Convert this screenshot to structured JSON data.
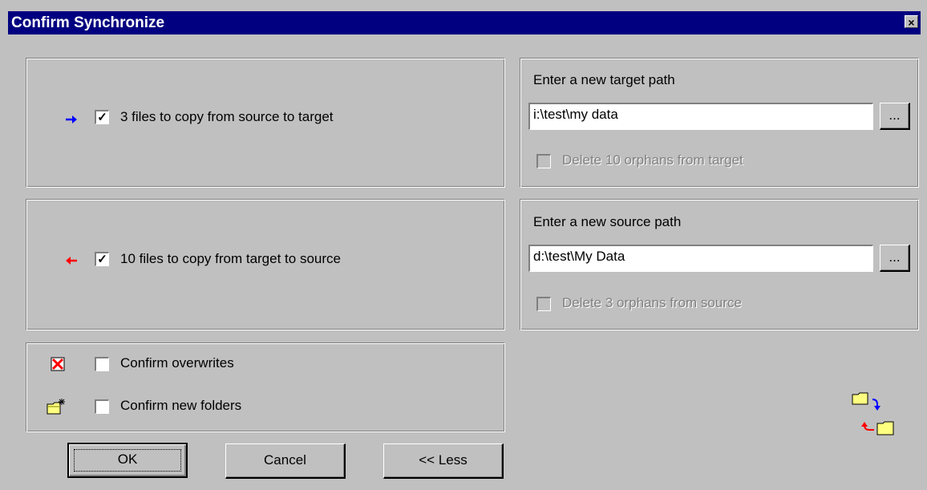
{
  "window": {
    "title": "Confirm Synchronize",
    "close_glyph": "×"
  },
  "copy_to_target": {
    "label": "3 files to copy from source to target",
    "checked": true,
    "arrow_color": "#0000ff"
  },
  "copy_to_source": {
    "label": "10 files to copy from target to source",
    "checked": true,
    "arrow_color": "#ff0000"
  },
  "target_path": {
    "heading": "Enter a new target path",
    "value": "i:\\test\\my data",
    "browse_label": "...",
    "delete_orphans_label": "Delete 10 orphans from target",
    "delete_orphans_enabled": false
  },
  "source_path": {
    "heading": "Enter a new source path",
    "value": "d:\\test\\My Data",
    "browse_label": "...",
    "delete_orphans_label": "Delete 3 orphans from source",
    "delete_orphans_enabled": false
  },
  "options": {
    "confirm_overwrites_label": "Confirm overwrites",
    "confirm_overwrites_checked": false,
    "confirm_new_folders_label": "Confirm new folders",
    "confirm_new_folders_checked": false
  },
  "buttons": {
    "ok": "OK",
    "cancel": "Cancel",
    "less": "<< Less"
  },
  "check_glyph": "✓",
  "icons": [
    "right-arrow-icon",
    "left-arrow-icon",
    "delete-x-icon",
    "new-folder-icon",
    "sync-folders-icon"
  ]
}
